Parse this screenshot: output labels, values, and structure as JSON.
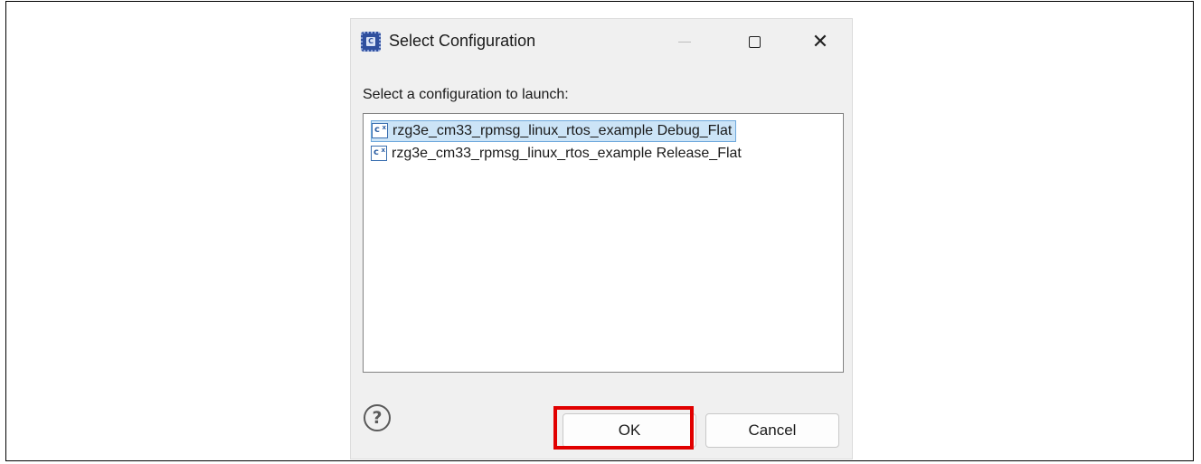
{
  "dialog": {
    "title": "Select Configuration",
    "prompt": "Select a configuration to launch:",
    "configurations": [
      {
        "label": "rzg3e_cm33_rpmsg_linux_rtos_example Debug_Flat",
        "selected": true
      },
      {
        "label": "rzg3e_cm33_rpmsg_linux_rtos_example Release_Flat",
        "selected": false
      }
    ],
    "buttons": {
      "ok": "OK",
      "cancel": "Cancel",
      "help": "?"
    },
    "window_controls": {
      "close": "✕"
    }
  },
  "icons": {
    "app": "eclipse-app-icon",
    "config": "c-launch-config-icon"
  },
  "colors": {
    "highlight": "#e10000",
    "selection": "#cce4f7",
    "selection_border": "#6fa9dc"
  }
}
